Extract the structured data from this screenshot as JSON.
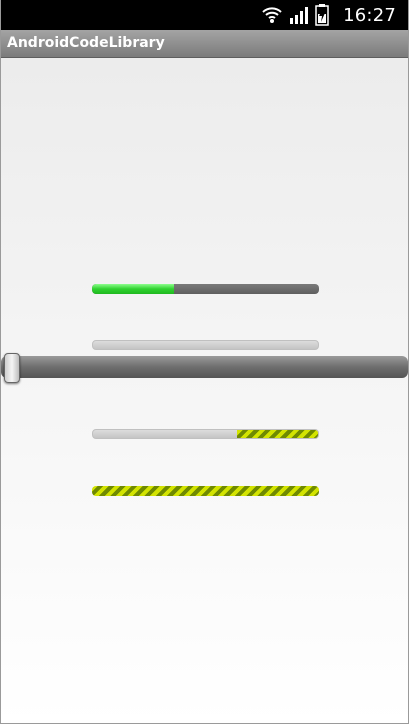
{
  "status_bar": {
    "time": "16:27",
    "icons": [
      "wifi-icon",
      "signal-icon",
      "battery-icon"
    ]
  },
  "app": {
    "title": "AndroidCodeLibrary"
  },
  "colors": {
    "progress_green": "#2fd22f",
    "stripe_yellow": "#d3e400",
    "stripe_olive": "#6f8a00",
    "track_dark": "#6e6e6e",
    "track_light": "#d0d0d0"
  },
  "controls": {
    "progress_1": {
      "style": "dark-track-green-fill",
      "progress": 0.36
    },
    "progress_2": {
      "style": "light-track",
      "progress": 0.0
    },
    "seekbar": {
      "progress": 0.0
    },
    "progress_3": {
      "style": "light-track-striped-fill",
      "progress": 0.36,
      "fill_from": "right"
    },
    "progress_4": {
      "style": "striped-fill",
      "progress": 1.0
    }
  }
}
